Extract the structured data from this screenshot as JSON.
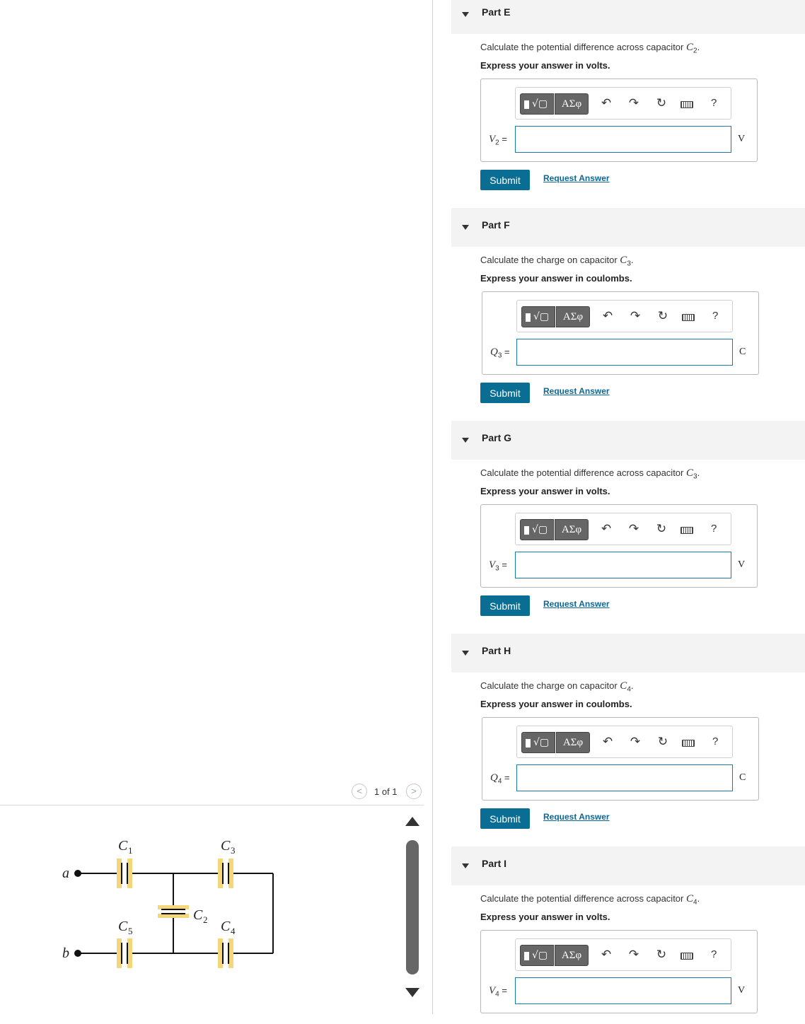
{
  "pager": {
    "label": "1 of 1",
    "prev_symbol": "<",
    "next_symbol": ">"
  },
  "figure": {
    "terminal_a": "a",
    "terminal_b": "b",
    "c1": "C",
    "c1_sub": "1",
    "c2": "C",
    "c2_sub": "2",
    "c3": "C",
    "c3_sub": "3",
    "c4": "C",
    "c4_sub": "4",
    "c5": "C",
    "c5_sub": "5"
  },
  "toolbar": {
    "template_symbol": "√▢",
    "greek_label": "ΑΣφ",
    "undo_icon": "↶",
    "redo_icon": "↷",
    "reset_icon": "↻",
    "help_label": "?"
  },
  "parts": [
    {
      "title": "Part E",
      "question_prefix": "Calculate the potential difference across capacitor ",
      "q_var": "C",
      "q_sub": "2",
      "question_suffix": ".",
      "express": "Express your answer in volts.",
      "var": "V",
      "var_sub": "2",
      "eq": " =",
      "input_value": "",
      "unit": "V",
      "submit": "Submit",
      "request": "Request Answer"
    },
    {
      "title": "Part F",
      "question_prefix": "Calculate the charge on capacitor ",
      "q_var": "C",
      "q_sub": "3",
      "question_suffix": ".",
      "express": "Express your answer in coulombs.",
      "var": "Q",
      "var_sub": "3",
      "eq": " =",
      "input_value": "",
      "unit": "C",
      "submit": "Submit",
      "request": "Request Answer"
    },
    {
      "title": "Part G",
      "question_prefix": "Calculate the potential difference across capacitor ",
      "q_var": "C",
      "q_sub": "3",
      "question_suffix": ".",
      "express": "Express your answer in volts.",
      "var": "V",
      "var_sub": "3",
      "eq": " =",
      "input_value": "",
      "unit": "V",
      "submit": "Submit",
      "request": "Request Answer"
    },
    {
      "title": "Part H",
      "question_prefix": "Calculate the charge on capacitor ",
      "q_var": "C",
      "q_sub": "4",
      "question_suffix": ".",
      "express": "Express your answer in coulombs.",
      "var": "Q",
      "var_sub": "4",
      "eq": " =",
      "input_value": "",
      "unit": "C",
      "submit": "Submit",
      "request": "Request Answer"
    },
    {
      "title": "Part I",
      "question_prefix": "Calculate the potential difference across capacitor ",
      "q_var": "C",
      "q_sub": "4",
      "question_suffix": ".",
      "express": "Express your answer in volts.",
      "var": "V",
      "var_sub": "4",
      "eq": " =",
      "input_value": "",
      "unit": "V"
    }
  ]
}
